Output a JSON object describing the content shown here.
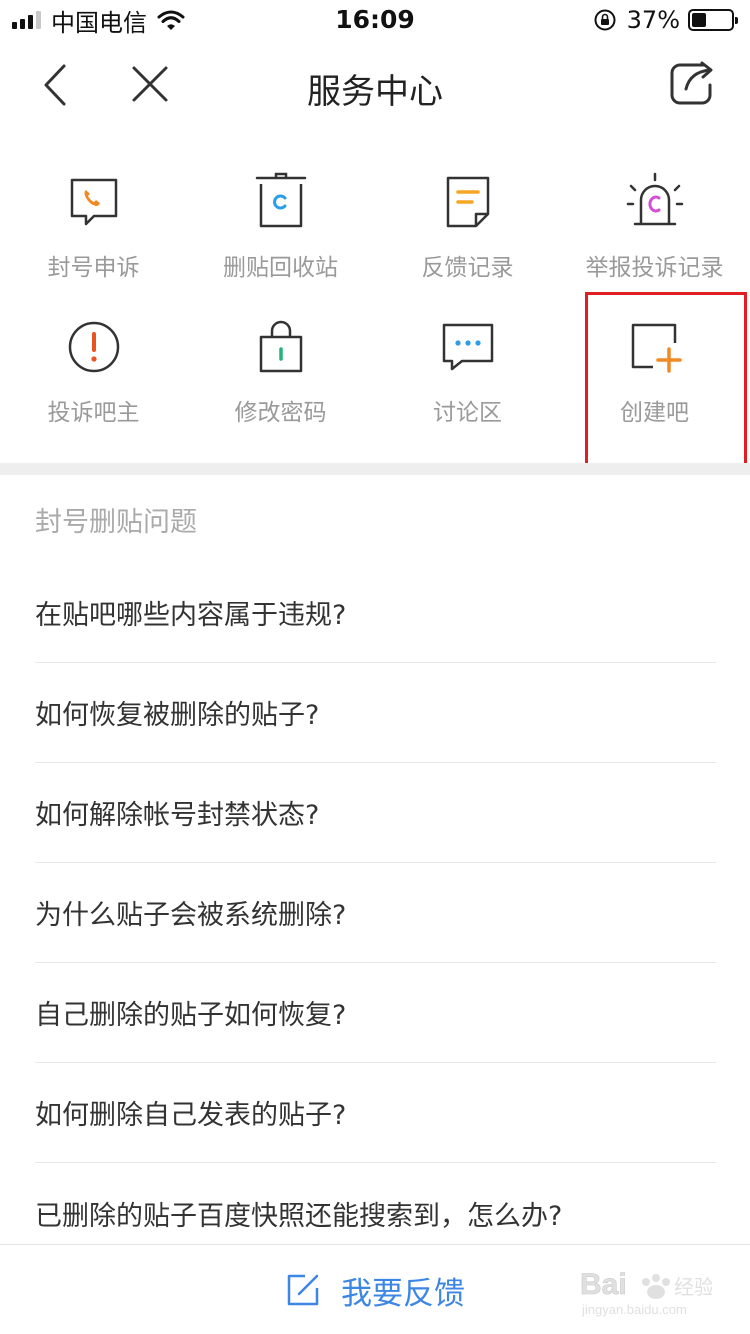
{
  "status_bar": {
    "carrier": "中国电信",
    "time": "16:09",
    "battery_percent": "37%",
    "battery_level": 0.37,
    "signal_bars_on": 3,
    "icons": [
      "signal-icon",
      "wifi-icon",
      "rotation-lock-icon",
      "battery-icon"
    ]
  },
  "nav": {
    "title": "服务中心",
    "icons": [
      "back-icon",
      "close-icon",
      "share-icon"
    ]
  },
  "grid": {
    "items": [
      {
        "label": "封号申诉",
        "icon": "phone-chat-icon"
      },
      {
        "label": "删贴回收站",
        "icon": "recycle-bin-icon"
      },
      {
        "label": "反馈记录",
        "icon": "document-icon"
      },
      {
        "label": "举报投诉记录",
        "icon": "alarm-bell-icon"
      },
      {
        "label": "投诉吧主",
        "icon": "exclamation-circle-icon"
      },
      {
        "label": "修改密码",
        "icon": "lock-bag-icon"
      },
      {
        "label": "讨论区",
        "icon": "chat-dots-icon"
      },
      {
        "label": "创建吧",
        "icon": "create-square-plus-icon"
      }
    ],
    "highlighted": "创建吧"
  },
  "section": {
    "title": "封号删贴问题"
  },
  "faq": [
    "在贴吧哪些内容属于违规?",
    "如何恢复被删除的贴子?",
    "如何解除帐号封禁状态?",
    "为什么贴子会被系统删除?",
    "自己删除的贴子如何恢复?",
    "如何删除自己发表的贴子?",
    "已删除的贴子百度快照还能搜索到，怎么办?"
  ],
  "bottom": {
    "feedback_label": "我要反馈",
    "icon": "edit-square-icon"
  },
  "colors": {
    "accent_blue": "#3e86e3",
    "orange": "#f08a24",
    "highlight_red": "#e02020",
    "label_gray": "#9a9a9a"
  },
  "watermark": {
    "text": "Bai经验",
    "subtext": "jingyan.baidu.com"
  }
}
